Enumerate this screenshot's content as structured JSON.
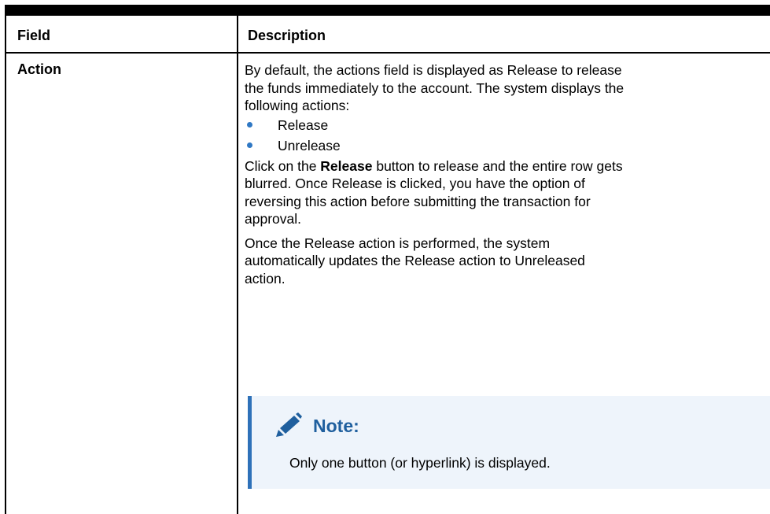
{
  "table": {
    "headers": {
      "field": "Field",
      "description": "Description"
    },
    "row": {
      "field": "Action",
      "description": {
        "intro_line1": "By default, the actions field is displayed as Release to release",
        "intro_line2": "the funds immediately to the account. The system displays the",
        "intro_line3": "following actions:",
        "bullets": [
          "Release",
          "Unrelease"
        ],
        "para2_prefix": "Click on the ",
        "para2_bold": "Release",
        "para2_suffix": " button to release and the entire row gets",
        "para2_line2": "blurred. Once Release is clicked, you have the option of",
        "para2_line3": "reversing this action before submitting the transaction for",
        "para2_line4": "approval.",
        "para3_line1": "Once the Release action is performed, the system",
        "para3_line2": "automatically updates the Release action to Unreleased",
        "para3_line3": "action."
      }
    }
  },
  "note": {
    "icon": "pencil-icon",
    "title": "Note:",
    "body": "Only one button (or hyperlink) is displayed."
  },
  "colors": {
    "rule": "#000000",
    "bullet": "#2f78c4",
    "note_background": "#eef4fb",
    "note_border": "#2e71b9",
    "note_title": "#1f5f9e"
  }
}
